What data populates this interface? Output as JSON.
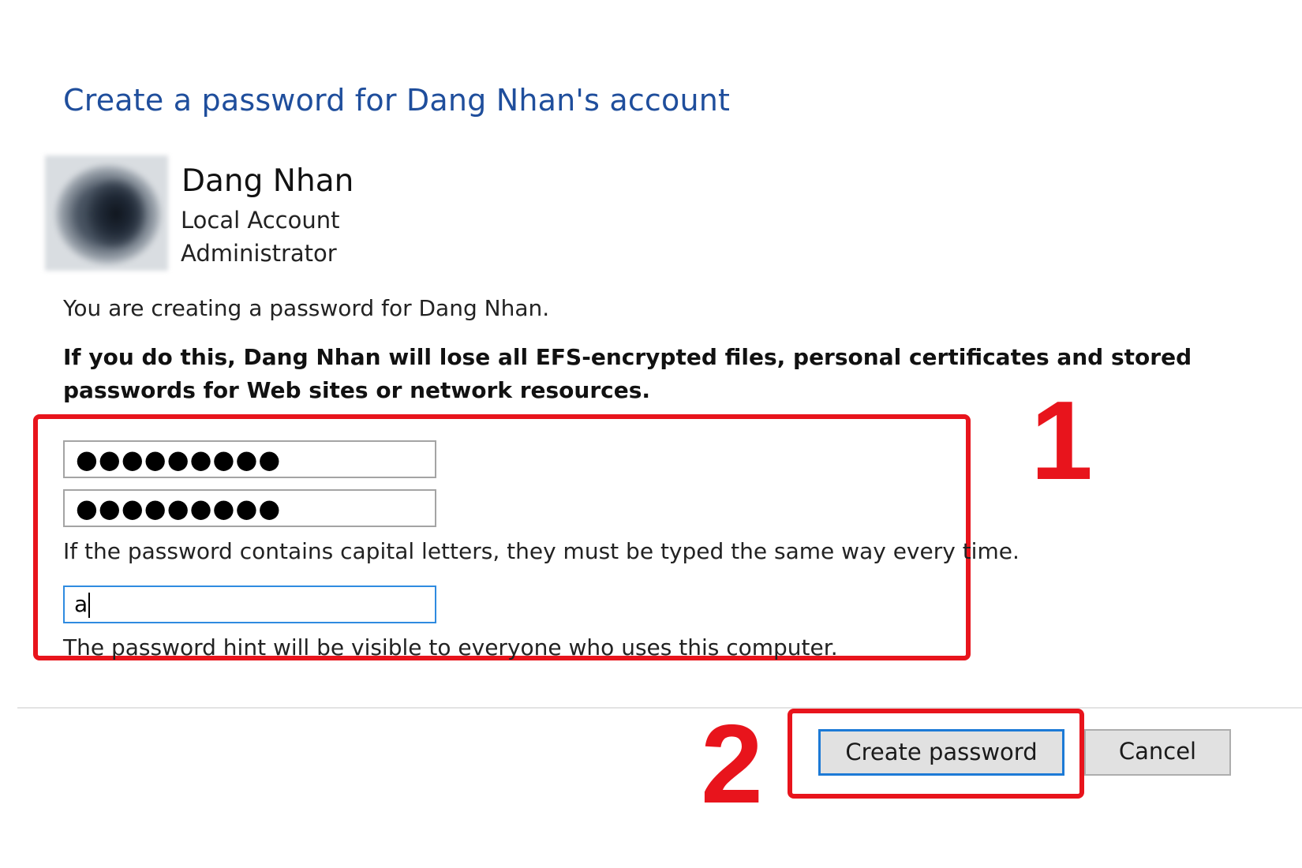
{
  "page": {
    "title": "Create a password for Dang Nhan's account"
  },
  "user": {
    "name": "Dang Nhan",
    "account_type": "Local Account",
    "role": "Administrator"
  },
  "info_text": "You are creating a password for Dang Nhan.",
  "warning_text": "If you do this, Dang Nhan will lose all EFS-encrypted files, personal certificates and stored passwords for Web sites or network resources.",
  "form": {
    "new_password_value": "●●●●●●●●●",
    "confirm_password_value": "●●●●●●●●●",
    "caps_note": "If the password contains capital letters, they must be typed the same way every time.",
    "hint_value": "a",
    "hint_note": "The password hint will be visible to everyone who uses this computer."
  },
  "buttons": {
    "create_label": "Create password",
    "cancel_label": "Cancel"
  },
  "annotations": {
    "marker_1": "1",
    "marker_2": "2",
    "highlight_color": "#e8141c"
  },
  "colors": {
    "title": "#1f4e9c",
    "focus_border": "#2f8be0",
    "default_button_border": "#1c7ad6"
  }
}
